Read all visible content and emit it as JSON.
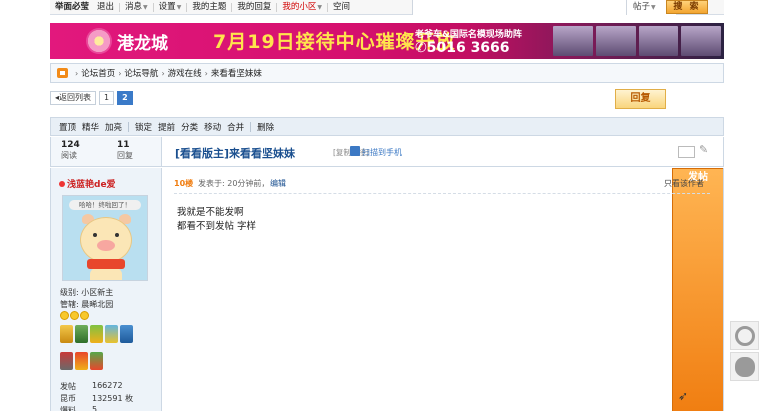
{
  "topbar": {
    "items": [
      "举面必莹",
      "退出",
      "消息",
      "设置",
      "我的主题",
      "我的回复",
      "我的小区",
      "空间"
    ],
    "search_category": "帖子",
    "search_button": "搜 索"
  },
  "banner": {
    "brand": "港龙城",
    "headline": "7月19日接待中心璀璨开放",
    "sub": "老爷车&国际名模现场助阵",
    "phone": "✆5016 3666"
  },
  "breadcrumb": [
    "论坛首页",
    "论坛导航",
    "游戏在线",
    "来看看坚妹妹"
  ],
  "pager": {
    "back": "◂返回列表",
    "pages": [
      "1",
      "2"
    ],
    "current": "2"
  },
  "actions": {
    "reply": "回复",
    "post": "发帖"
  },
  "modbar": [
    "置顶",
    "精华",
    "加亮",
    "锁定",
    "提前",
    "分类",
    "移动",
    "合并",
    "删除"
  ],
  "thread": {
    "views": "124",
    "views_label": "阅读",
    "replies": "11",
    "replies_label": "回复",
    "title": "[看看版主]来看看坚妹妹",
    "copy_link": "[复制链接]",
    "qr_text": "扫描到手机"
  },
  "user": {
    "name": "浅蓝艳de爱",
    "avatar_text": "哈哈！终啦回了！",
    "level": "级别: 小区新主",
    "manage": "管辖: 晨晞北园",
    "stats": [
      {
        "k": "发帖",
        "v": "166272"
      },
      {
        "k": "昆币",
        "v": "132591 枚"
      },
      {
        "k": "爆料",
        "v": "5"
      }
    ]
  },
  "post": {
    "floor": "10楼",
    "posted": "发表于: 20分钟前，",
    "edit": "编辑",
    "only_author": "只看该作者",
    "lines": [
      "我就是不能发啊",
      "都看不到发帖 字样"
    ]
  },
  "colors": {
    "accent": "#3a7ac8",
    "orange": "#f07d10",
    "banner_pink": "#e2187d"
  },
  "float_icons": [
    "headset-icon",
    "wechat-icon"
  ]
}
